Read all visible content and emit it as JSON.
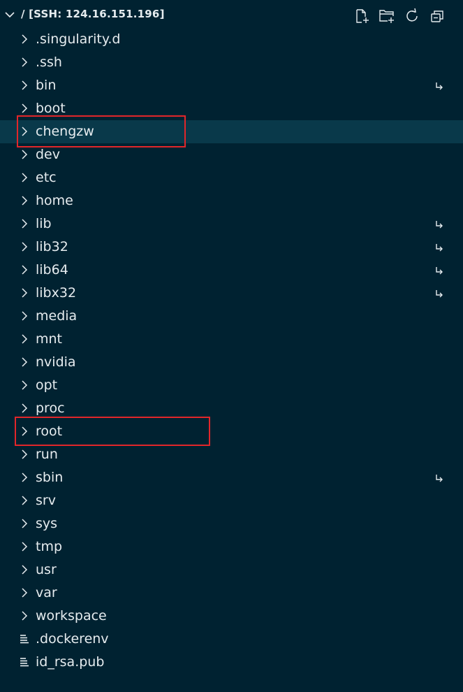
{
  "explorer": {
    "title": "/ [SSH: 124.16.151.196]",
    "actions": [
      "new-file-icon",
      "new-folder-icon",
      "refresh-icon",
      "collapse-all-icon"
    ]
  },
  "tree": {
    "items": [
      {
        "label": ".singularity.d",
        "type": "folder",
        "symlink": false
      },
      {
        "label": ".ssh",
        "type": "folder",
        "symlink": false
      },
      {
        "label": "bin",
        "type": "folder",
        "symlink": true
      },
      {
        "label": "boot",
        "type": "folder",
        "symlink": false
      },
      {
        "label": "chengzw",
        "type": "folder",
        "symlink": false,
        "selected": true
      },
      {
        "label": "dev",
        "type": "folder",
        "symlink": false
      },
      {
        "label": "etc",
        "type": "folder",
        "symlink": false
      },
      {
        "label": "home",
        "type": "folder",
        "symlink": false
      },
      {
        "label": "lib",
        "type": "folder",
        "symlink": true
      },
      {
        "label": "lib32",
        "type": "folder",
        "symlink": true
      },
      {
        "label": "lib64",
        "type": "folder",
        "symlink": true
      },
      {
        "label": "libx32",
        "type": "folder",
        "symlink": true
      },
      {
        "label": "media",
        "type": "folder",
        "symlink": false
      },
      {
        "label": "mnt",
        "type": "folder",
        "symlink": false
      },
      {
        "label": "nvidia",
        "type": "folder",
        "symlink": false
      },
      {
        "label": "opt",
        "type": "folder",
        "symlink": false
      },
      {
        "label": "proc",
        "type": "folder",
        "symlink": false
      },
      {
        "label": "root",
        "type": "folder",
        "symlink": false
      },
      {
        "label": "run",
        "type": "folder",
        "symlink": false
      },
      {
        "label": "sbin",
        "type": "folder",
        "symlink": true
      },
      {
        "label": "srv",
        "type": "folder",
        "symlink": false
      },
      {
        "label": "sys",
        "type": "folder",
        "symlink": false
      },
      {
        "label": "tmp",
        "type": "folder",
        "symlink": false
      },
      {
        "label": "usr",
        "type": "folder",
        "symlink": false
      },
      {
        "label": "var",
        "type": "folder",
        "symlink": false
      },
      {
        "label": "workspace",
        "type": "folder",
        "symlink": false
      },
      {
        "label": ".dockerenv",
        "type": "file",
        "symlink": false
      },
      {
        "label": "id_rsa.pub",
        "type": "file",
        "symlink": false
      }
    ]
  },
  "annotations": {
    "highlighted_items": [
      "chengzw",
      "root"
    ],
    "color": "#e2262a"
  },
  "colors": {
    "background": "#002231",
    "selected_row": "#09394a",
    "text": "#e6ecef"
  }
}
